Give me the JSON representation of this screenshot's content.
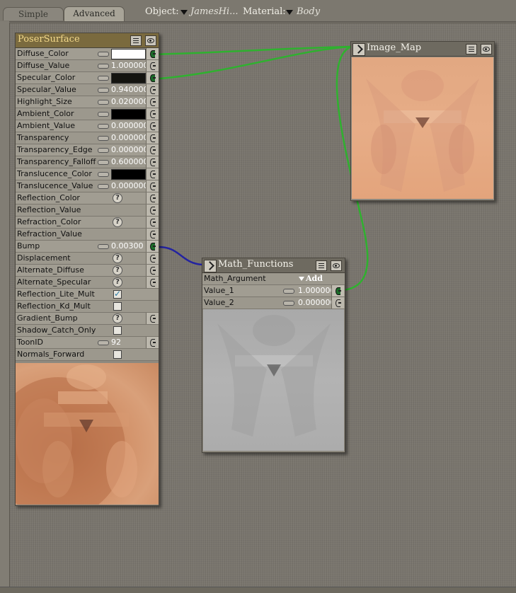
{
  "tabs": [
    {
      "label": "Simple",
      "active": false
    },
    {
      "label": "Advanced",
      "active": true
    }
  ],
  "toolbar": {
    "object_label": "Object:",
    "object_value": "JamesHi...",
    "material_label": "Material:",
    "material_value": "Body"
  },
  "poser_surface": {
    "title": "PoserSurface",
    "rows": [
      {
        "label": "Diffuse_Color",
        "kind": "color",
        "color": "#ffffff",
        "connected": true
      },
      {
        "label": "Diffuse_Value",
        "kind": "value",
        "value": "1.000000",
        "connected": false
      },
      {
        "label": "Specular_Color",
        "kind": "color",
        "color": "#141410",
        "connected": true
      },
      {
        "label": "Specular_Value",
        "kind": "value",
        "value": "0.940000",
        "connected": false
      },
      {
        "label": "Highlight_Size",
        "kind": "value",
        "value": "0.020000",
        "connected": false
      },
      {
        "label": "Ambient_Color",
        "kind": "color",
        "color": "#000000",
        "connected": false
      },
      {
        "label": "Ambient_Value",
        "kind": "value",
        "value": "0.000000",
        "connected": false
      },
      {
        "label": "Transparency",
        "kind": "value",
        "value": "0.000000",
        "connected": false
      },
      {
        "label": "Transparency_Edge",
        "kind": "value",
        "value": "0.000000",
        "connected": false
      },
      {
        "label": "Transparency_Falloff",
        "kind": "value",
        "value": "0.600000",
        "connected": false
      },
      {
        "label": "Translucence_Color",
        "kind": "color",
        "color": "#000000",
        "connected": false
      },
      {
        "label": "Translucence_Value",
        "kind": "value",
        "value": "0.000000",
        "connected": false
      },
      {
        "label": "Reflection_Color",
        "kind": "help",
        "connected": false
      },
      {
        "label": "Reflection_Value",
        "kind": "empty",
        "connected": false
      },
      {
        "label": "Refraction_Color",
        "kind": "help",
        "connected": false
      },
      {
        "label": "Refraction_Value",
        "kind": "empty",
        "connected": false
      },
      {
        "label": "Bump",
        "kind": "value",
        "value": "0.00300",
        "connected": true
      },
      {
        "label": "Displacement",
        "kind": "help",
        "connected": false
      },
      {
        "label": "Alternate_Diffuse",
        "kind": "help",
        "connected": false
      },
      {
        "label": "Alternate_Specular",
        "kind": "help",
        "connected": false
      },
      {
        "label": "Reflection_Lite_Mult",
        "kind": "check",
        "checked": true
      },
      {
        "label": "Reflection_Kd_Mult",
        "kind": "check",
        "checked": false
      },
      {
        "label": "Gradient_Bump",
        "kind": "help",
        "connected": false
      },
      {
        "label": "Shadow_Catch_Only",
        "kind": "check",
        "checked": false
      },
      {
        "label": "ToonID",
        "kind": "value",
        "value": "92",
        "connected": false
      },
      {
        "label": "Normals_Forward",
        "kind": "check",
        "checked": false
      }
    ]
  },
  "image_map": {
    "title": "Image_Map"
  },
  "math_functions": {
    "title": "Math_Functions",
    "argument_label": "Math_Argument",
    "argument_value": "Add",
    "rows": [
      {
        "label": "Value_1",
        "value": "1.000000",
        "connected": true
      },
      {
        "label": "Value_2",
        "value": "0.000000",
        "connected": false
      }
    ]
  },
  "colors": {
    "wire_green": "#2fb12f",
    "wire_blue": "#2323a0",
    "poser_title": "#f3d98a"
  }
}
